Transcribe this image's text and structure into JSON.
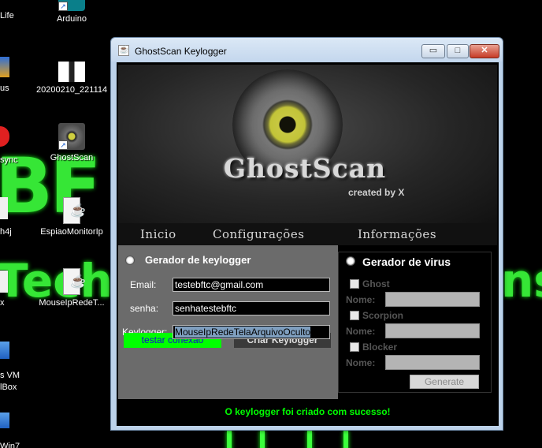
{
  "desktop": {
    "wallpaper": {
      "left_text": "BF",
      "tech_text_left": "Tech",
      "tech_text_right": "ns",
      "accent": "#3cff3c"
    },
    "left_edge_labels": [
      "Life",
      "us",
      "sync",
      "h4j",
      "x",
      "s VM",
      "lBox",
      "Win7"
    ],
    "icons": [
      {
        "label": "Arduino",
        "icon": "arduino-icon"
      },
      {
        "label": "20200210_221114",
        "icon": "image-icon"
      },
      {
        "label": "GhostScan",
        "icon": "eye-icon"
      },
      {
        "label": "EspiaoMonitorIp",
        "icon": "java-file-icon"
      },
      {
        "label": "MouseIpRedeT...",
        "icon": "java-file-icon"
      }
    ]
  },
  "window": {
    "title": "GhostScan Keylogger",
    "controls": {
      "minimize": "▭",
      "maximize": "□",
      "close": "✕"
    },
    "banner": {
      "logo": "GhostScan",
      "credit": "created by X"
    },
    "nav": [
      "Inicio",
      "Configurações",
      "Informações"
    ],
    "keylogger": {
      "title": "Gerador de keylogger",
      "email_label": "Email:",
      "email_value": "testebftc@gmail.com",
      "password_label": "senha:",
      "password_value": "senhatestebftc",
      "keylogger_label": "Keylogger:",
      "keylogger_value": "MouseIpRedeTelaArquivoOculto",
      "test_button": "testar conexão",
      "create_button": "Criar Keylogger"
    },
    "virus": {
      "title": "Gerador de virus",
      "options": [
        {
          "label": "Ghost",
          "checked": false
        },
        {
          "label": "Scorpion",
          "checked": false
        },
        {
          "label": "Blocker",
          "checked": false
        }
      ],
      "name_label": "Nome:",
      "generate_button": "Generate"
    },
    "status": "O keylogger foi criado com sucesso!"
  }
}
